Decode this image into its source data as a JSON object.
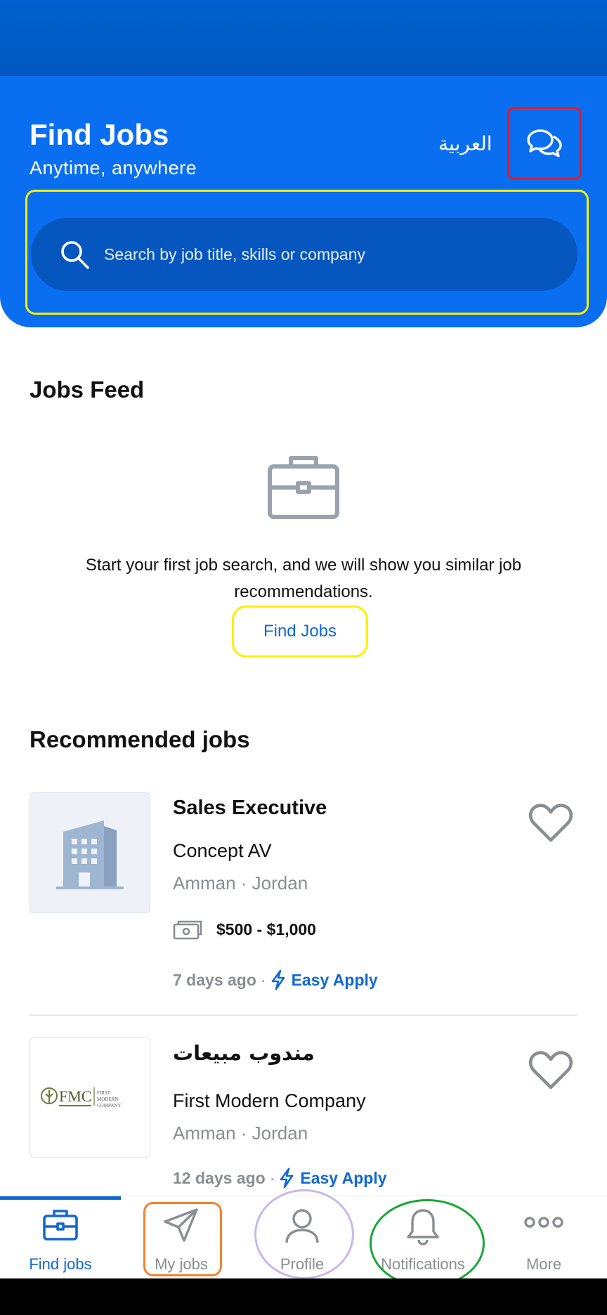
{
  "header": {
    "title": "Find Jobs",
    "subtitle": "Anytime, anywhere",
    "language": "العربية",
    "search_placeholder": "Search by job title, skills or company"
  },
  "feed": {
    "title": "Jobs Feed",
    "empty_message": "Start your first job search, and we will show you similar job recommendations.",
    "cta": "Find Jobs"
  },
  "recommended": {
    "title": "Recommended jobs",
    "jobs": [
      {
        "title": "Sales Executive",
        "company": "Concept AV",
        "location": "Amman · Jordan",
        "salary": "$500 - $1,000",
        "posted": "7 days ago",
        "apply": "Easy Apply"
      },
      {
        "title": "مندوب مبيعات",
        "company": "First Modern Company",
        "location": "Amman · Jordan",
        "posted": "12 days ago",
        "apply": "Easy Apply",
        "logo_text": "FMC",
        "logo_sub": "FIRST MODERN COMPANY"
      }
    ]
  },
  "nav": {
    "items": [
      {
        "label": "Find jobs",
        "icon": "briefcase-icon",
        "active": true
      },
      {
        "label": "My jobs",
        "icon": "paper-plane-icon"
      },
      {
        "label": "Profile",
        "icon": "person-icon"
      },
      {
        "label": "Notifications",
        "icon": "bell-icon"
      },
      {
        "label": "More",
        "icon": "more-dots-icon"
      }
    ]
  },
  "colors": {
    "primary": "#0a6ef0",
    "accent_link": "#1268d3",
    "highlight_red": "#e11b2d",
    "highlight_yellow": "#ffee00",
    "highlight_orange": "#f5822a",
    "highlight_purple": "#c8b8ee",
    "highlight_green": "#1aa637"
  }
}
